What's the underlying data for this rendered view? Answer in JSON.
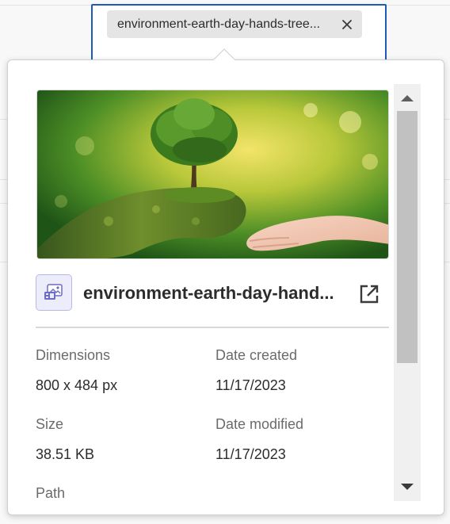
{
  "tag": {
    "label": "environment-earth-day-hands-tree...",
    "remove_icon": "close-icon"
  },
  "asset": {
    "file_name": "environment-earth-day-hand...",
    "file_icon": "image-file-icon",
    "open_icon": "open-external-icon"
  },
  "metadata": {
    "dimensions_label": "Dimensions",
    "dimensions_value": "800 x 484 px",
    "date_created_label": "Date created",
    "date_created_value": "11/17/2023",
    "size_label": "Size",
    "size_value": "38.51 KB",
    "date_modified_label": "Date modified",
    "date_modified_value": "11/17/2023",
    "path_label": "Path"
  },
  "colors": {
    "focus_border": "#1e5bb8",
    "chip_bg": "#e5e5e5",
    "file_icon_bg": "#ececfb"
  }
}
